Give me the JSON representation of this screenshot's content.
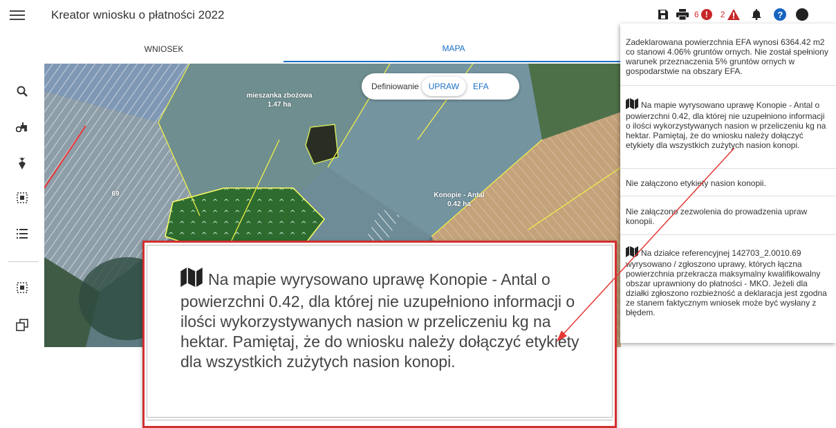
{
  "app": {
    "title": "Kreator wniosku o płatności 2022"
  },
  "toolbar": {
    "error_count": "6",
    "error_symbol": "!",
    "warning_count": "2",
    "warning_symbol": "!",
    "help_symbol": "?",
    "icons": [
      "save-icon",
      "print-icon",
      "error-icon",
      "warning-icon",
      "bell-icon",
      "help-icon",
      "user-icon"
    ]
  },
  "tabs": [
    {
      "label": "WNIOSEK",
      "active": false
    },
    {
      "label": "MAPA",
      "active": true
    }
  ],
  "sidebar": {
    "items": [
      "search-icon",
      "tractor-icon",
      "crop-icon",
      "select-icon",
      "list-icon",
      "select-area-icon",
      "copy-icon"
    ]
  },
  "map": {
    "mode_label": "Definiowanie",
    "mode_options": [
      {
        "label": "UPRAW",
        "active": true
      },
      {
        "label": "EFA",
        "active": false
      }
    ],
    "labels": [
      {
        "name": "mieszanka zbożowa",
        "area": "1.47 ha"
      },
      {
        "name": "69",
        "area": ""
      },
      {
        "name": "Konopie - Antal",
        "area": "0.42 ha"
      }
    ]
  },
  "notifications": [
    {
      "icon": "",
      "text": "Zadeklarowana powierzchnia EFA wynosi 6364.42 m2 co stanowi 4.06% gruntów ornych. Nie został spełniony warunek przeznaczenia 5% gruntów ornych w gospodarstwie na obszary EFA."
    },
    {
      "icon": "map-icon",
      "text": "Na mapie wyrysowano uprawę Konopie - Antal o powierzchni 0.42, dla której nie uzupełniono informacji o ilości wykorzystywanych nasion w przeliczeniu kg na hektar. Pamiętaj, że do wniosku należy dołączyć etykiety dla wszystkich zużytych nasion konopi."
    },
    {
      "icon": "",
      "text": "Nie załączono etykiety nasion konopii."
    },
    {
      "icon": "",
      "text": "Nie załączono zezwolenia do prowadzenia upraw konopii."
    },
    {
      "icon": "map-icon",
      "text": "Na działce referencyjnej 142703_2.0010.69 wyrysowano / zgłoszono uprawy, których łączna powierzchnia przekracza maksymalny kwalifikowalny obszar uprawniony do płatności - MKO. Jeżeli dla działki zgłoszono rozbieżność a deklaracja jest zgodna ze stanem faktycznym wniosek może być wysłany z błędem."
    }
  ],
  "callout": {
    "icon": "map-icon",
    "text": "Na mapie wyrysowano uprawę Konopie - Antal o powierzchni 0.42, dla której nie uzupełniono informacji o ilości wykorzystywanych nasion w przeliczeniu kg na hektar. Pamiętaj, że do wniosku należy dołączyć etykiety dla wszystkich zużytych nasion konopi."
  },
  "colors": {
    "accent": "#1a6fc4",
    "error": "#c62828",
    "callout_border": "#d32f2f",
    "map_field": "#6f8e99",
    "crop_polygon": "#2e6b2e"
  }
}
